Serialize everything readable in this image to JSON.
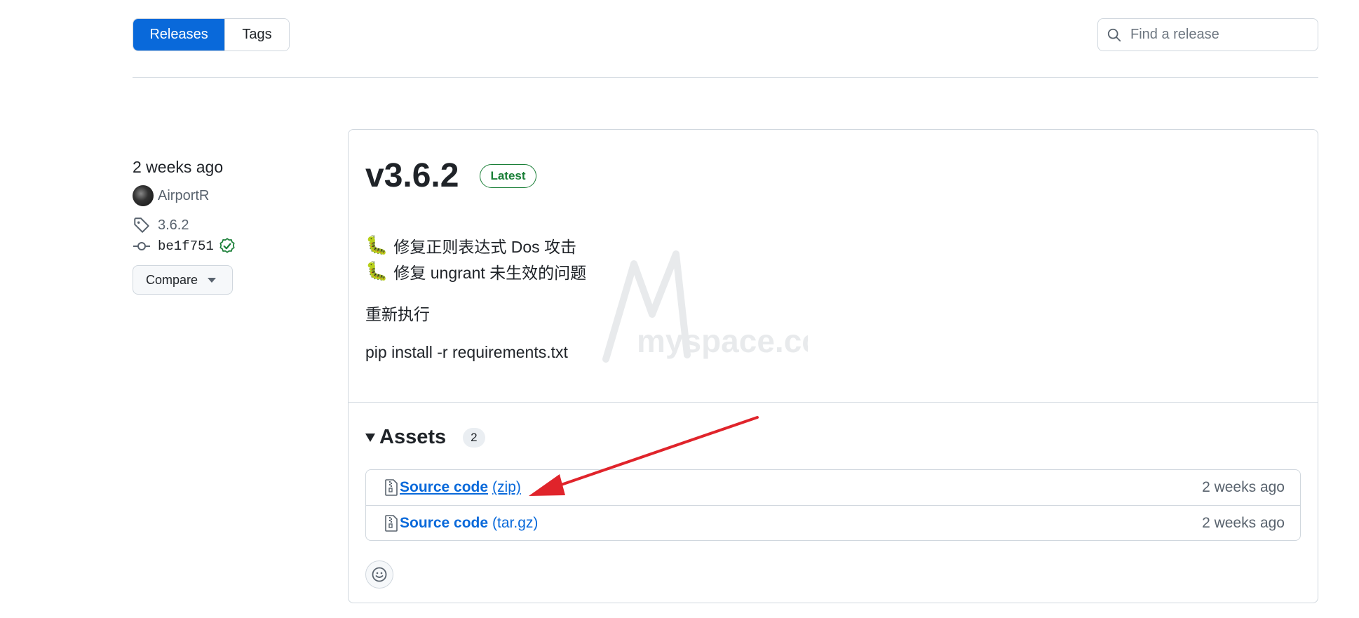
{
  "tabs": {
    "releases": "Releases",
    "tags": "Tags"
  },
  "search": {
    "placeholder": "Find a release"
  },
  "release": {
    "time": "2 weeks ago",
    "author": "AirportR",
    "tag": "3.6.2",
    "commit": "be1f751",
    "compare_label": "Compare",
    "title": "v3.6.2",
    "badge": "Latest",
    "notes": {
      "fix1": "修复正则表达式 Dos 攻击",
      "fix2": "修复 ungrant 未生效的问题",
      "para1": "重新执行",
      "para2": "pip install -r requirements.txt"
    },
    "assets_label": "Assets",
    "assets_count": "2",
    "assets": [
      {
        "name": "Source code",
        "format": "(zip)",
        "time": "2 weeks ago"
      },
      {
        "name": "Source code",
        "format": "(tar.gz)",
        "time": "2 weeks ago"
      }
    ]
  },
  "watermark": "myspace.cc",
  "colors": {
    "accent": "#0969da",
    "latest": "#1a7f37",
    "annotation": "#e0242b"
  },
  "icons": [
    "search-icon",
    "person-avatar",
    "tag-icon",
    "commit-icon",
    "verified-check-icon",
    "caret-down-icon",
    "caterpillar-emoji",
    "file-zip-icon",
    "smiley-icon"
  ]
}
